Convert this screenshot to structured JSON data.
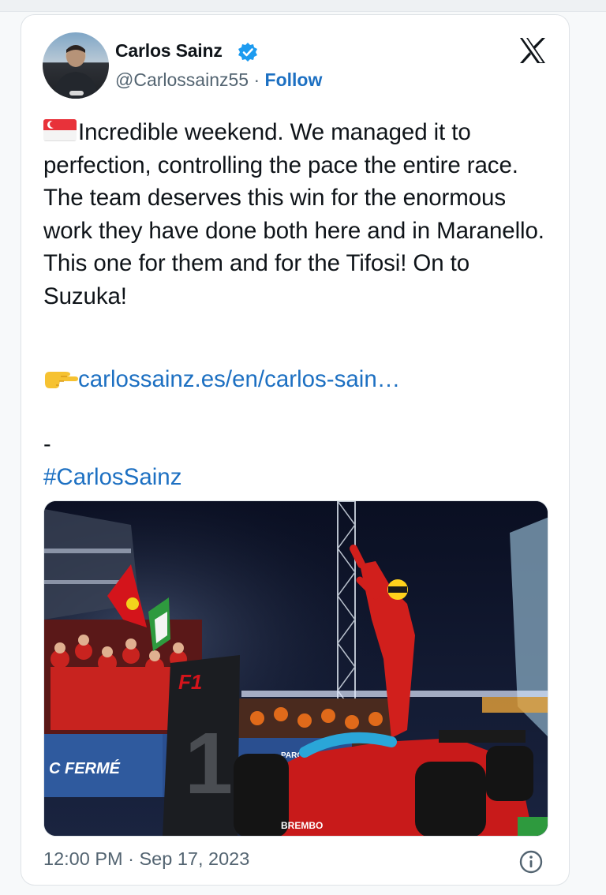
{
  "author": {
    "name": "Carlos Sainz",
    "handle": "@Carlossainz55",
    "separator": " · ",
    "follow_label": "Follow"
  },
  "tweet": {
    "flag_icon": "singapore-flag-icon",
    "text": "Incredible weekend. We managed it to perfection, controlling the pace the entire race. The team deserves this win for the enormous work they have done both here and in Maranello. This one for them and for the Tifosi! On to Suzuka!",
    "link_icon": "pointing-hand-icon",
    "link_text": "carlossainz.es/en/carlos-sain…",
    "dash": "-",
    "hashtag": "#CarlosSainz"
  },
  "photo": {
    "board_number": "1",
    "banner_text": "C FERMÉ",
    "small_banner_text": "PARC FERM"
  },
  "footer": {
    "timestamp": "12:00 PM · Sep 17, 2023"
  },
  "colors": {
    "link": "#1d70c2",
    "verified": "#1d9bf0",
    "text": "#0f1419",
    "muted": "#536471"
  }
}
